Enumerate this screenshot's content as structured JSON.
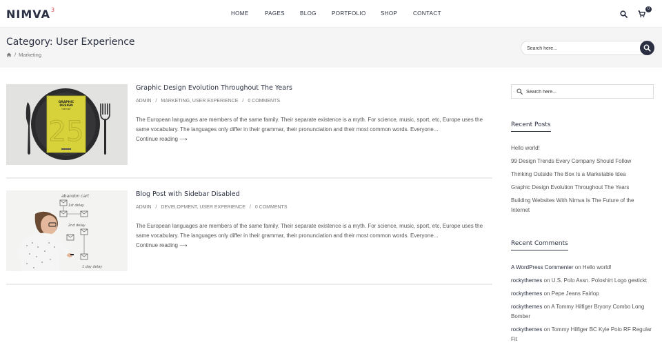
{
  "header": {
    "logo": "NIMVA",
    "logo_sup": "3",
    "nav": [
      "HOME",
      "PAGES",
      "BLOG",
      "PORTFOLIO",
      "SHOP",
      "CONTACT"
    ],
    "cart_count": "0"
  },
  "titleband": {
    "title": "Category: User Experience",
    "breadcrumb_sep": "/",
    "breadcrumb_current": "Marketing",
    "search_placeholder": "Search here..."
  },
  "posts": [
    {
      "title": "Graphic Design Evolution Throughout The Years",
      "author": "ADMIN",
      "sep1": "/",
      "categories": "MARKETING, USER EXPERIENCE",
      "sep2": "/",
      "comments": "0 COMMENTS",
      "excerpt": "The European languages are members of the same family. Their separate existence is a myth. For science, music, sport, etc, Europe uses the same vocabulary. The languages only differ in their grammar, their pronunciation and their most common words. Everyone...",
      "continue": "Continue reading ⟶"
    },
    {
      "title": "Blog Post with Sidebar Disabled",
      "author": "ADMIN",
      "sep1": "/",
      "categories": "DEVELOPMENT, USER EXPERIENCE",
      "sep2": "/",
      "comments": "0 COMMENTS",
      "excerpt": "The European languages are members of the same family. Their separate existence is a myth. For science, music, sport, etc, Europe uses the same vocabulary. The languages only differ in their grammar, their pronunciation and their most common words. Everyone...",
      "continue": "Continue reading ⟶"
    }
  ],
  "sidebar": {
    "search_placeholder": "Search here...",
    "recent_posts_title": "Recent Posts",
    "recent_posts": [
      "Hello world!",
      "99 Design Trends Every Company Should Follow",
      "Thinking Outside The Box Is a Marketable Idea",
      "Graphic Design Evolution Throughout The Years",
      "Building Websites With Nimva Is The Future of the Internet"
    ],
    "recent_comments_title": "Recent Comments",
    "recent_comments": [
      {
        "author": "A WordPress Commenter",
        "on": "on",
        "post": "Hello world!"
      },
      {
        "author": "rockythemes",
        "on": "on",
        "post": "U.S. Polo Assn. Poloshirt Logo gestickt"
      },
      {
        "author": "rockythemes",
        "on": "on",
        "post": "Pepe Jeans Fairlop"
      },
      {
        "author": "rockythemes",
        "on": "on",
        "post": "A Tommy Hilfiger Bryony Combo Long Bomber"
      },
      {
        "author": "rockythemes",
        "on": "on",
        "post": "Tommy Hilfiger BC Kyle Polo RF Regular Fit"
      }
    ]
  },
  "thumb1": {
    "book_line1": "GRAPHIC",
    "book_line2": "DESIGN",
    "book_line3": "HISTORY",
    "book_number": "25"
  },
  "thumb2": {
    "board_top": "abandon cart",
    "board_label1": "1st delay",
    "board_label2": "2nd delay",
    "board_label3": "1 day delay"
  }
}
